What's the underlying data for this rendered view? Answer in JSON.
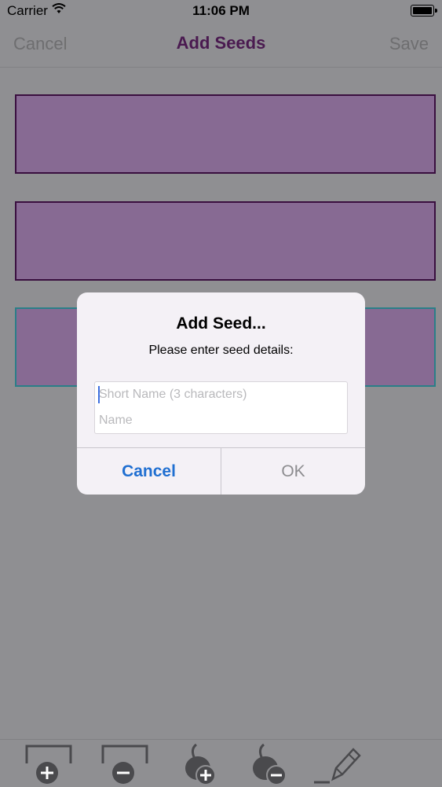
{
  "status_bar": {
    "carrier": "Carrier",
    "time": "11:06 PM"
  },
  "nav": {
    "cancel": "Cancel",
    "title": "Add Seeds",
    "save": "Save"
  },
  "slots": [
    {
      "state": "normal"
    },
    {
      "state": "normal"
    },
    {
      "state": "selected"
    }
  ],
  "alert": {
    "title": "Add Seed...",
    "message": "Please enter seed details:",
    "short_name_placeholder": "Short Name (3 characters)",
    "short_name_value": "",
    "name_placeholder": "Name",
    "name_value": "",
    "cancel_label": "Cancel",
    "ok_label": "OK"
  },
  "toolbar": {
    "icons": [
      "add-slot-icon",
      "remove-slot-icon",
      "add-seed-icon",
      "remove-seed-icon",
      "edit-pencil-icon"
    ]
  },
  "colors": {
    "title": "#4a1a50",
    "slot_fill": "#876a93",
    "slot_border": "#3a0f3f",
    "selected_border": "#2a7f88",
    "alert_cancel": "#1f6fd1",
    "dim_background": "#8f8f92"
  }
}
